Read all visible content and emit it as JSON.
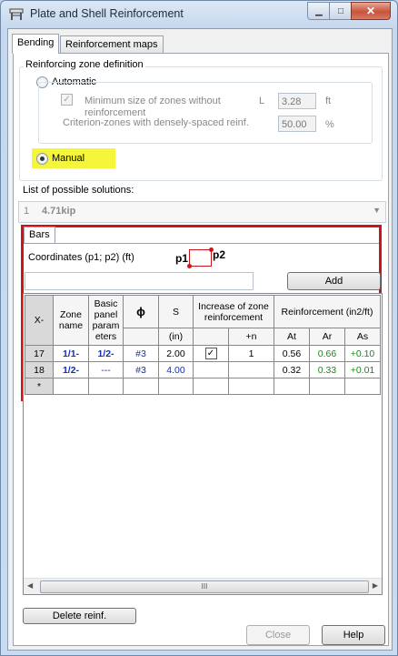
{
  "window": {
    "title": "Plate and Shell Reinforcement"
  },
  "tabs": [
    {
      "label": "Bending"
    },
    {
      "label": "Reinforcement maps"
    }
  ],
  "zone_definition": {
    "legend": "Reinforcing zone definition",
    "automatic_label": "Automatic",
    "min_size_label_1": "Minimum size of zones without",
    "min_size_label_2": "reinforcement",
    "min_size_symbol": "L",
    "min_size_value": "3.28",
    "min_size_unit": "ft",
    "criterion_label": "Criterion-zones with densely-spaced reinf.",
    "criterion_value": "50.00",
    "criterion_unit": "%",
    "manual_label": "Manual",
    "highlight_color": "#f5f53a"
  },
  "solutions": {
    "label": "List of possible solutions:",
    "index": "1",
    "value": "4.71kip"
  },
  "bars_tab": {
    "label": "Bars"
  },
  "coordinates": {
    "label": "Coordinates (p1; p2) (ft)",
    "p1": "p1",
    "p2": "p2",
    "input_value": ""
  },
  "add_button": "Add",
  "grid": {
    "headers": {
      "x": "X-",
      "zone_name": "Zone name",
      "basic_panel": "Basic panel param eters",
      "phi": "ϕ",
      "s": "S",
      "s_unit": "(in)",
      "increase": "Increase of zone reinforcement",
      "plus_n": "+n",
      "reinforcement": "Reinforcement (in2/ft)",
      "at": "At",
      "ar": "Ar",
      "as": "As"
    },
    "rows": [
      {
        "x": "17",
        "zone": "1/1-",
        "basic": "1/2-",
        "phi": "#3",
        "s": "2.00",
        "increase": true,
        "n": "1",
        "at": "0.56",
        "ar": "0.66",
        "as": "+0.10"
      },
      {
        "x": "18",
        "zone": "1/2-",
        "basic": "---",
        "phi": "#3",
        "s": "4.00",
        "increase": false,
        "n": "",
        "at": "0.32",
        "ar": "0.33",
        "as": "+0.01"
      }
    ],
    "new_row_marker": "*"
  },
  "scrollbar": {
    "grip": "III"
  },
  "delete_button": "Delete reinf.",
  "footer": {
    "close_label": "Close",
    "help_label": "Help"
  },
  "accent": {
    "red_frame": "#c8161b",
    "green_text": "#178a17",
    "blue_text": "#1230b8"
  }
}
